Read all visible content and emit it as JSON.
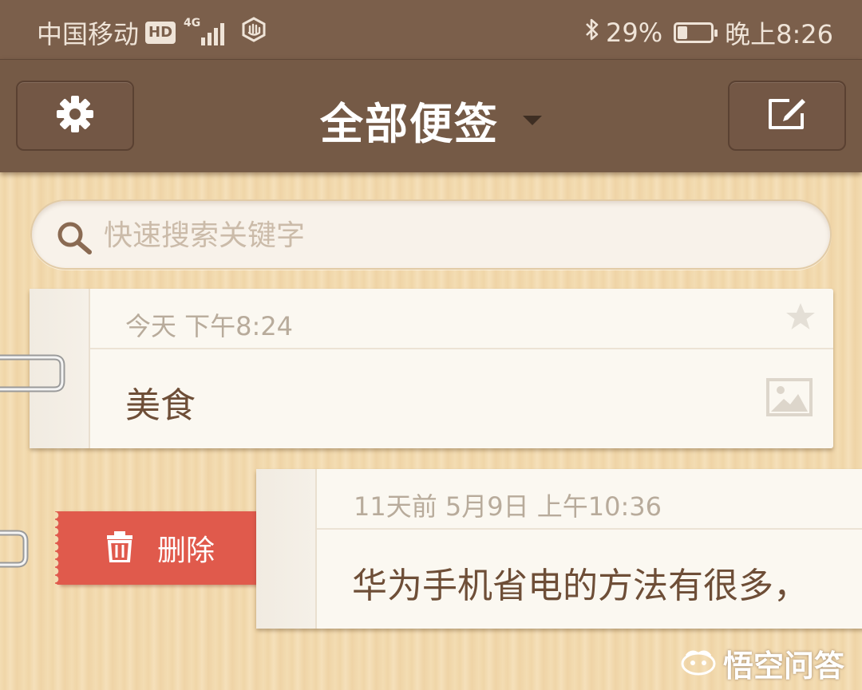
{
  "status_bar": {
    "carrier": "中国移动",
    "hd_badge": "HD",
    "network": "4G",
    "battery_percent": "29%",
    "battery_level": 0.29,
    "time": "晚上8:26"
  },
  "header": {
    "title": "全部便签",
    "settings_icon": "gear-icon",
    "compose_icon": "compose-icon"
  },
  "search": {
    "placeholder": "快速搜索关键字",
    "value": ""
  },
  "notes": [
    {
      "date": "今天 下午8:24",
      "content": "美食",
      "starred": false,
      "has_image": true
    },
    {
      "date": "11天前 5月9日 上午10:36",
      "content": "华为手机省电的方法有很多，"
    }
  ],
  "swipe_action": {
    "label": "删除",
    "icon": "trash-icon",
    "color": "#e05a4c"
  },
  "watermark": {
    "text": "悟空问答"
  },
  "colors": {
    "header_bg": "#755a46",
    "status_bg": "#7b5f4b",
    "note_text": "#6e4e37",
    "date_text": "#b8ab9b"
  }
}
